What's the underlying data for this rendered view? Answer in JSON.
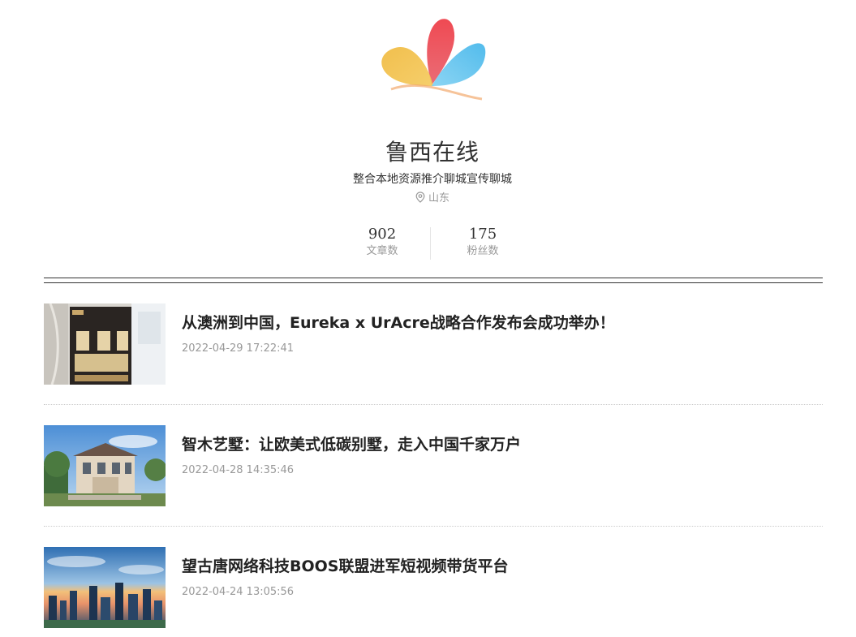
{
  "profile": {
    "name": "鲁西在线",
    "description": "整合本地资源推介聊城宣传聊城",
    "location": "山东",
    "logo_icon": "butterfly-logo-icon",
    "stats": [
      {
        "value": "902",
        "label": "文章数"
      },
      {
        "value": "175",
        "label": "粉丝数"
      }
    ]
  },
  "articles": [
    {
      "title": "从澳洲到中国，Eureka x UrAcre战略合作发布会成功举办！",
      "date": "2022-04-29 17:22:41",
      "thumb_icon": "event-poster-image"
    },
    {
      "title": "智木艺墅：让欧美式低碳别墅，走入中国千家万户",
      "date": "2022-04-28 14:35:46",
      "thumb_icon": "villa-photo-image"
    },
    {
      "title": "望古唐网络科技BOOS联盟进军短视频带货平台",
      "date": "2022-04-24 13:05:56",
      "thumb_icon": "city-skyline-image"
    }
  ],
  "colors": {
    "text_primary": "#222222",
    "text_muted": "#999999",
    "logo_red": "#e8414b",
    "logo_yellow": "#f2b33a",
    "logo_blue": "#45b8e8"
  }
}
